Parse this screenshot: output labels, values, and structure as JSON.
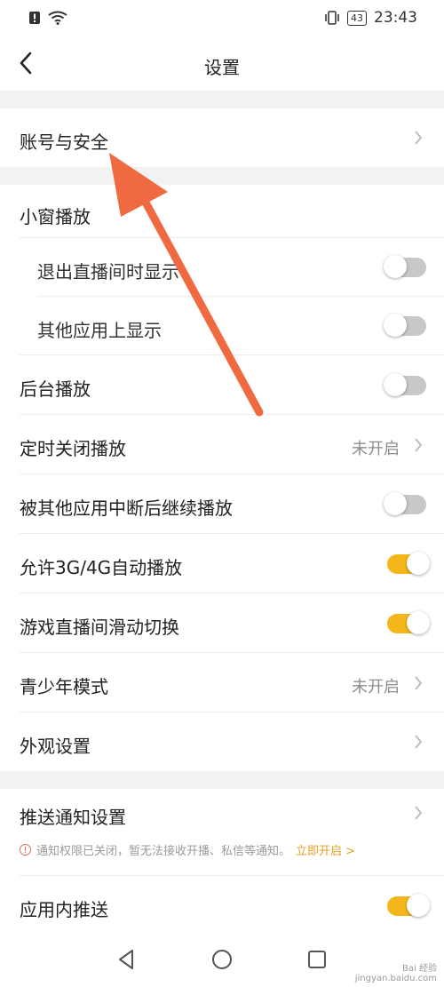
{
  "status_bar": {
    "time": "23:43",
    "battery": "43"
  },
  "header": {
    "title": "设置"
  },
  "rows": {
    "account": {
      "label": "账号与安全"
    },
    "mini_window": {
      "label": "小窗播放"
    },
    "exit_live_show": {
      "label": "退出直播间时显示",
      "on": false
    },
    "other_apps_show": {
      "label": "其他应用上显示",
      "on": false
    },
    "background_play": {
      "label": "后台播放",
      "on": false
    },
    "timed_close": {
      "label": "定时关闭播放",
      "value": "未开启"
    },
    "resume_after_interrupt": {
      "label": "被其他应用中断后继续播放",
      "on": false
    },
    "allow_3g4g_autoplay": {
      "label": "允许3G/4G自动播放",
      "on": true
    },
    "game_live_swipe": {
      "label": "游戏直播间滑动切换",
      "on": true
    },
    "teen_mode": {
      "label": "青少年模式",
      "value": "未开启"
    },
    "appearance": {
      "label": "外观设置"
    },
    "push_notification": {
      "label": "推送通知设置"
    },
    "in_app_push": {
      "label": "应用内推送",
      "on": true
    }
  },
  "notice": {
    "icon": "warning-icon",
    "text": "通知权限已关闭，暂无法接收开播、私信等通知。",
    "link": "立即开启 >"
  },
  "watermark": {
    "line1": "Bai 经验",
    "line2": "jingyan.baidu.com"
  },
  "colors": {
    "accent": "#f4b61a",
    "annotation_arrow": "#ef6a40",
    "toggle_off": "#c8c8c8"
  }
}
